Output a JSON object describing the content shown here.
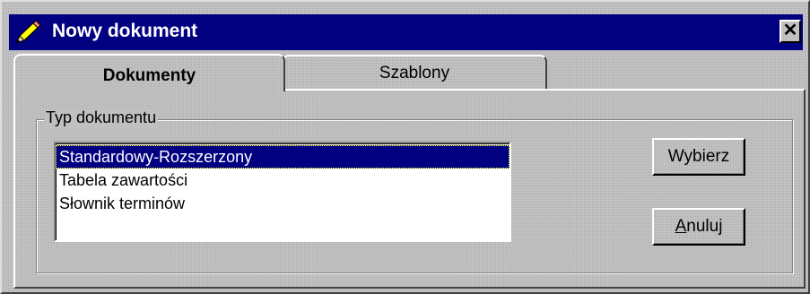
{
  "window": {
    "title": "Nowy dokument",
    "icon": "pencil-icon",
    "close_glyph": "✕",
    "colors": {
      "titlebar": "#000080",
      "face": "#c0c0c0",
      "selection": "#000080"
    }
  },
  "tabs": [
    {
      "label": "Dokumenty",
      "active": true
    },
    {
      "label": "Szablony",
      "active": false
    }
  ],
  "group": {
    "label": "Typ dokumentu",
    "items": [
      {
        "label": "Standardowy-Rozszerzony",
        "selected": true
      },
      {
        "label": "Tabela zawartości",
        "selected": false
      },
      {
        "label": "Słownik terminów",
        "selected": false
      }
    ]
  },
  "buttons": {
    "select": "Wybierz",
    "cancel_accel": "A",
    "cancel_rest": "nuluj"
  }
}
